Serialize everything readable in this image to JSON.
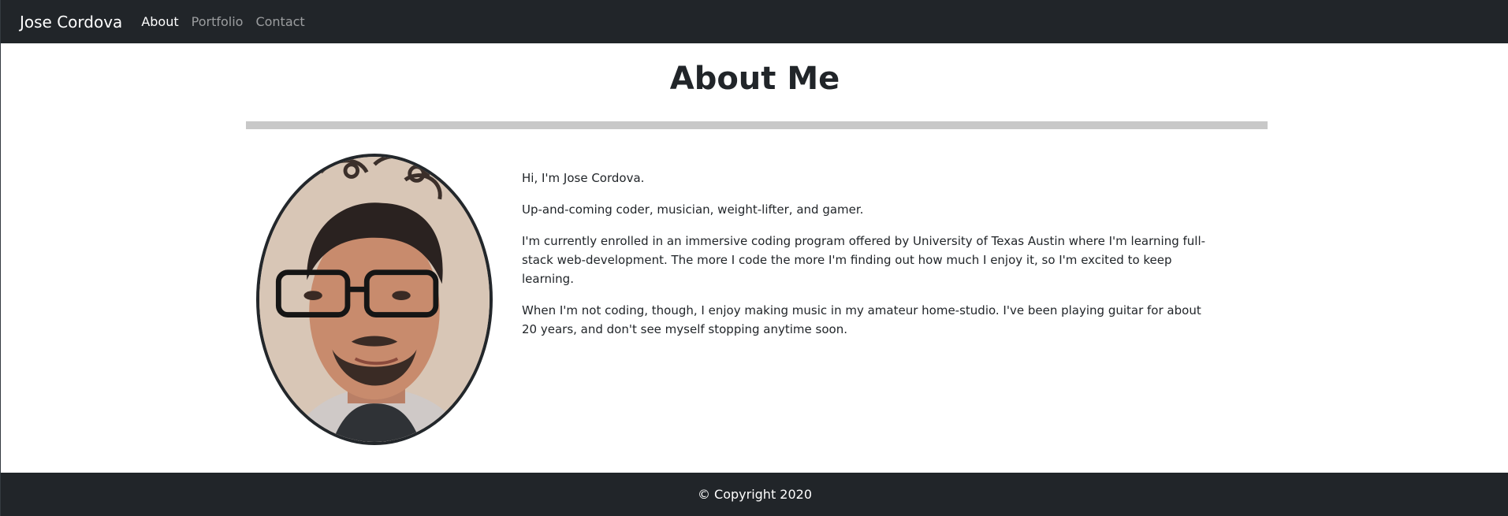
{
  "navbar": {
    "brand": "Jose Cordova",
    "links": [
      {
        "label": "About",
        "active": true
      },
      {
        "label": "Portfolio",
        "active": false
      },
      {
        "label": "Contact",
        "active": false
      }
    ]
  },
  "main": {
    "title": "About Me",
    "photo_alt": "Jose Cordova",
    "paragraphs": [
      "Hi, I'm Jose Cordova.",
      "Up-and-coming coder, musician, weight-lifter, and gamer.",
      "I'm currently enrolled in an immersive coding program offered by University of Texas Austin where I'm learning full-stack web-development. The more I code the more I'm finding out how much I enjoy it, so I'm excited to keep learning.",
      "When I'm not coding, though, I enjoy making music in my amateur home-studio. I've been playing guitar for about 20 years, and don't see myself stopping anytime soon."
    ]
  },
  "footer": {
    "copyright": "© Copyright 2020"
  },
  "colors": {
    "navbar_bg": "#212529",
    "footer_bg": "#212529",
    "divider": "#c8c8c8",
    "text": "#212529"
  }
}
